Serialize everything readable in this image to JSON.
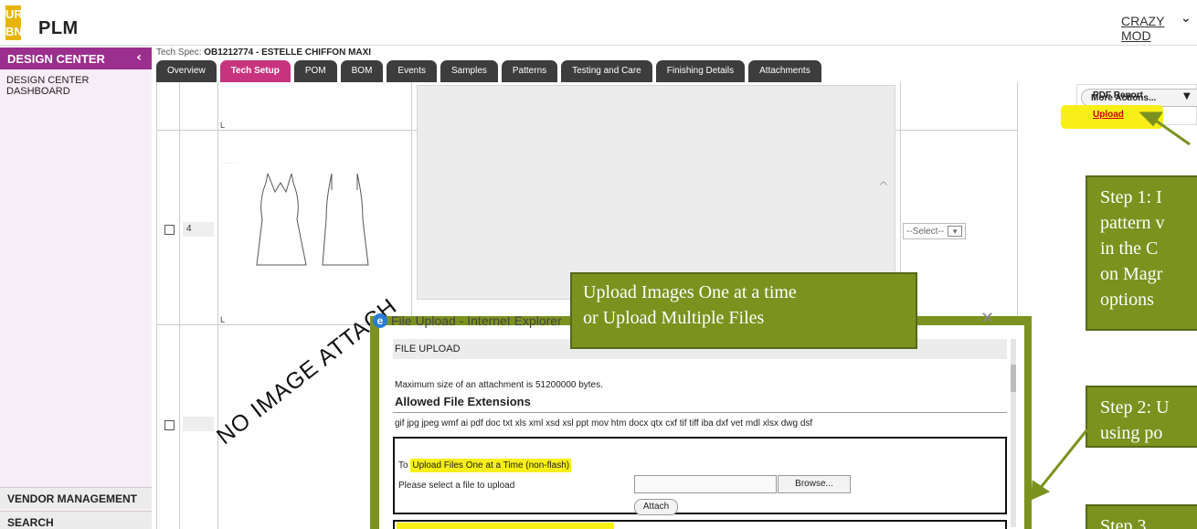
{
  "app": {
    "logo_letters": [
      "UR",
      "BN"
    ],
    "name": "PLM",
    "user": "CRAZY MOD",
    "colors": {
      "brand_purple": "#9b2f8e",
      "active_tab": "#c8337f",
      "callout_green": "#7b921f",
      "highlight_yellow": "#f7ef17"
    }
  },
  "sidebar": {
    "header": "DESIGN CENTER",
    "items": [
      "DESIGN CENTER DASHBOARD"
    ],
    "bottom_items": [
      "VENDOR MANAGEMENT",
      "SEARCH"
    ]
  },
  "techspec": {
    "label": "Tech Spec:",
    "value": "OB1212774 - ESTELLE CHIFFON MAXI"
  },
  "tabs": [
    "Overview",
    "Tech Setup",
    "POM",
    "BOM",
    "Events",
    "Samples",
    "Patterns",
    "Testing and Care",
    "Finishing Details",
    "Attachments"
  ],
  "active_tab": "Tech Setup",
  "rows": [
    {
      "num": "",
      "marker": "L"
    },
    {
      "num": "4",
      "marker": "L",
      "select": "--Select--"
    },
    {
      "num": "",
      "image_text": "NO IMAGE ATTACH"
    }
  ],
  "actions": {
    "button": "More Actions...",
    "items": [
      "PDF Report",
      "Upload"
    ]
  },
  "callouts": {
    "step1": "Step 1: I\npattern v\nin the C\non Magr\noptions",
    "step2": "Step 2: U\nusing po",
    "step3": "Step 3",
    "upload_note": "Upload Images One at a time\nor Upload Multiple Files"
  },
  "dialog": {
    "title": "File Upload - Internet Explorer",
    "bar": "FILE UPLOAD",
    "max_size": "Maximum size of an attachment is 51200000 bytes.",
    "allowed_heading": "Allowed File Extensions",
    "extensions": "gif jpg jpeg wmf ai pdf doc txt xls xml xsd xsl ppt mov htm docx qtx cxf tif tiff iba dxf vet mdl xlsx dwg dsf",
    "to_label": "To",
    "one_at_a_time": "Upload Files One at a Time (non-flash)",
    "select_prompt": "Please select a file to upload",
    "browse": "Browse...",
    "attach": "Attach"
  }
}
